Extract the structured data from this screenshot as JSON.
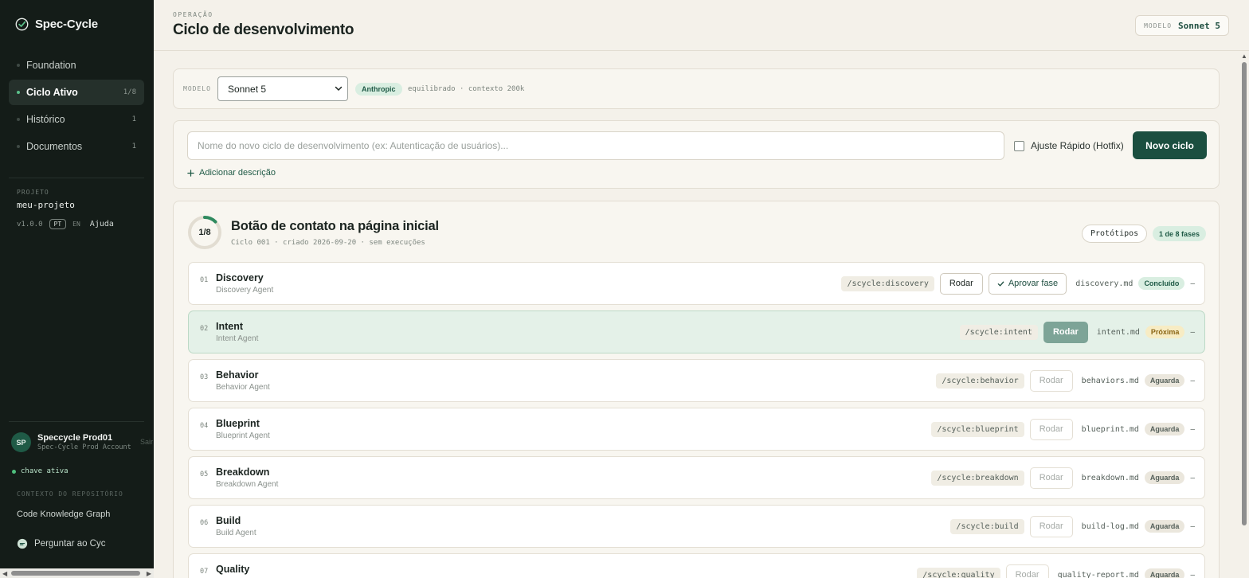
{
  "brand": {
    "name": "Spec-Cycle"
  },
  "nav": [
    {
      "label": "Foundation",
      "count": "",
      "active": false
    },
    {
      "label": "Ciclo Ativo",
      "count": "1/8",
      "active": true
    },
    {
      "label": "Histórico",
      "count": "1",
      "active": false
    },
    {
      "label": "Documentos",
      "count": "1",
      "active": false
    }
  ],
  "project": {
    "label": "PROJETO",
    "name": "meu-projeto",
    "version": "v1.0.0",
    "lang_pt": "PT",
    "lang_en": "EN",
    "help": "Ajuda"
  },
  "user": {
    "initials": "SP",
    "name": "Speccycle Prod01",
    "account": "Spec-Cycle Prod Account",
    "logout": "Sair"
  },
  "key_status": "chave ativa",
  "repo_context": {
    "label": "CONTEXTO DO REPOSITÓRIO",
    "graph": "Code Knowledge Graph",
    "ask": "Perguntar ao Cyc"
  },
  "header": {
    "breadcrumb": "OPERAÇÃO",
    "title": "Ciclo de desenvolvimento",
    "model_label": "MODELO",
    "model_value": "Sonnet 5"
  },
  "model_card": {
    "label": "MODELO",
    "selected": "Sonnet 5",
    "provider": "Anthropic",
    "description": "equilibrado · contexto 200k"
  },
  "new_cycle": {
    "placeholder": "Nome do novo ciclo de desenvolvimento (ex: Autenticação de usuários)...",
    "hotfix_label": "Ajuste Rápido (Hotfix)",
    "button": "Novo ciclo",
    "add_description": "Adicionar descrição"
  },
  "cycle": {
    "progress_text": "1/8",
    "progress_fraction": 0.125,
    "title": "Botão de contato na página inicial",
    "meta": "Ciclo 001 · criado 2026-09-20 · sem execuções",
    "prototypes_button": "Protótipos",
    "phases_badge": "1 de 8 fases",
    "phases": [
      {
        "num": "01",
        "name": "Discovery",
        "agent": "Discovery Agent",
        "cmd": "/scycle:discovery",
        "run": "Rodar",
        "run_state": "enabled",
        "approve": "Aprovar fase",
        "file": "discovery.md",
        "status": "Concluído",
        "status_type": "done",
        "dash": "–"
      },
      {
        "num": "02",
        "name": "Intent",
        "agent": "Intent Agent",
        "cmd": "/scycle:intent",
        "run": "Rodar",
        "run_state": "primary",
        "approve": "",
        "file": "intent.md",
        "status": "Próxima",
        "status_type": "next",
        "dash": "–"
      },
      {
        "num": "03",
        "name": "Behavior",
        "agent": "Behavior Agent",
        "cmd": "/scycle:behavior",
        "run": "Rodar",
        "run_state": "disabled",
        "approve": "",
        "file": "behaviors.md",
        "status": "Aguarda",
        "status_type": "wait",
        "dash": "–"
      },
      {
        "num": "04",
        "name": "Blueprint",
        "agent": "Blueprint Agent",
        "cmd": "/scycle:blueprint",
        "run": "Rodar",
        "run_state": "disabled",
        "approve": "",
        "file": "blueprint.md",
        "status": "Aguarda",
        "status_type": "wait",
        "dash": "–"
      },
      {
        "num": "05",
        "name": "Breakdown",
        "agent": "Breakdown Agent",
        "cmd": "/scycle:breakdown",
        "run": "Rodar",
        "run_state": "disabled",
        "approve": "",
        "file": "breakdown.md",
        "status": "Aguarda",
        "status_type": "wait",
        "dash": "–"
      },
      {
        "num": "06",
        "name": "Build",
        "agent": "Build Agent",
        "cmd": "/scycle:build",
        "run": "Rodar",
        "run_state": "disabled",
        "approve": "",
        "file": "build-log.md",
        "status": "Aguarda",
        "status_type": "wait",
        "dash": "–"
      },
      {
        "num": "07",
        "name": "Quality",
        "agent": "",
        "cmd": "/scycle:quality",
        "run": "Rodar",
        "run_state": "disabled",
        "approve": "",
        "file": "quality-report.md",
        "status": "Aguarda",
        "status_type": "wait",
        "dash": "–"
      }
    ]
  },
  "colors": {
    "sidebar_bg": "#141c18",
    "accent": "#1b4f40",
    "accent_light": "#d9eee1",
    "page_bg": "#f4f1ea",
    "next_row_bg": "#e4f1e8"
  },
  "icons": {
    "brand": "check-circle-icon",
    "ask": "chat-bubble-icon",
    "approve": "check-icon",
    "add": "plus-icon",
    "select": "chevron-down-icon"
  }
}
